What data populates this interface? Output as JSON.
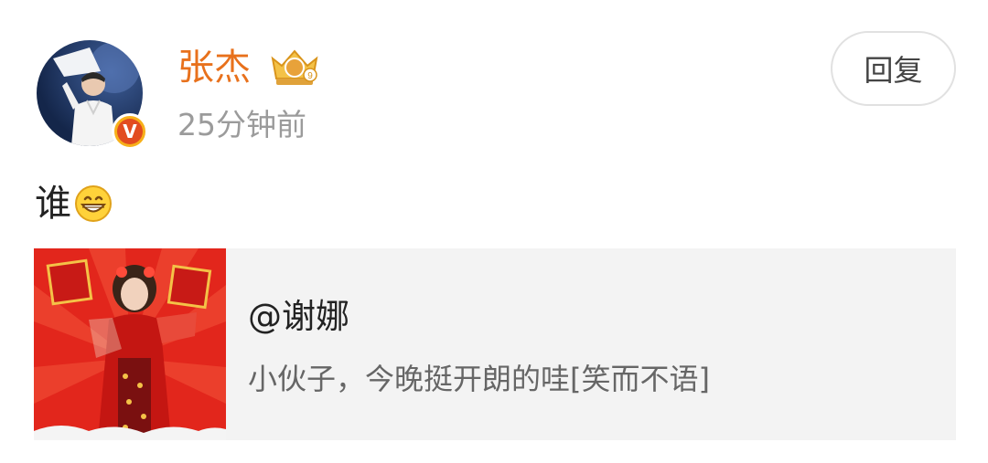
{
  "post": {
    "author": {
      "name": "张杰",
      "verified_icon": "verified-v-badge",
      "vip_icon": "vip-crown-badge"
    },
    "time": "25分钟前",
    "reply_label": "回复",
    "comment_text": "谁",
    "comment_emoji": "grin-emoji-icon"
  },
  "quote": {
    "user": "@谢娜",
    "text": "小伙子，今晚挺开朗的哇[笑而不语]",
    "thumbnail_icon": "red-festive-photo"
  },
  "colors": {
    "name": "#e8711c",
    "time": "#9b9b9b",
    "card_bg": "#f3f3f3",
    "badge": "#f7b01a"
  }
}
